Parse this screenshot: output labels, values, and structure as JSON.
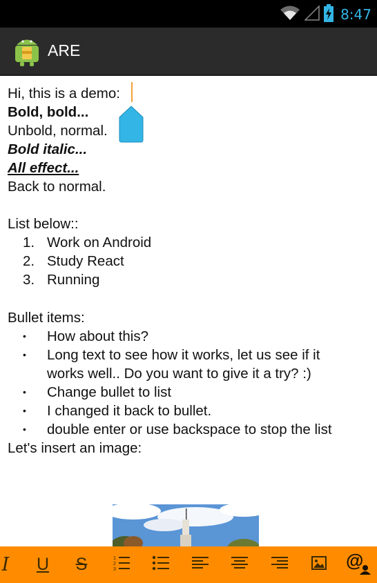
{
  "status_bar": {
    "time": "8:47",
    "icons": [
      "wifi-icon",
      "signal-icon",
      "battery-charging-icon"
    ]
  },
  "app_bar": {
    "title": "ARE",
    "icon": "android-app-icon"
  },
  "editor": {
    "lines": {
      "l1": "Hi, this is a demo:",
      "l2": "Bold, bold...",
      "l3": "Unbold, normal.",
      "l4": "Bold italic...",
      "l5": "All effect...",
      "l6": "Back to normal.",
      "l7": "List below::",
      "l8": "Bullet items:",
      "l9": "Let's insert an image:"
    },
    "numbered_list": [
      {
        "num": "1.",
        "text": "Work on Android"
      },
      {
        "num": "2.",
        "text": "Study React"
      },
      {
        "num": "3.",
        "text": "Running"
      }
    ],
    "bullet_marker": "•",
    "bullet_list": [
      {
        "text": "How about this?"
      },
      {
        "text": "Long text to see how it works, let us see if it",
        "cont": "works well.. Do you want to give it a try? :)"
      },
      {
        "text": "Change bullet to list"
      },
      {
        "text": "I changed it back to bullet."
      },
      {
        "text": "double enter or use backspace to stop the list"
      }
    ]
  },
  "toolbar": {
    "buttons": [
      "italic-icon",
      "underline-icon",
      "strikethrough-icon",
      "numbered-list-icon",
      "bulleted-list-icon",
      "align-left-icon",
      "align-center-icon",
      "align-right-icon",
      "insert-image-icon",
      "mention-icon"
    ],
    "labels": {
      "italic": "I",
      "underline": "U",
      "strike": "S"
    },
    "background": "#ff8c00"
  },
  "colors": {
    "accent": "#33b5e5",
    "cursor": "#f2a23a",
    "handle": "#33b5e5"
  }
}
